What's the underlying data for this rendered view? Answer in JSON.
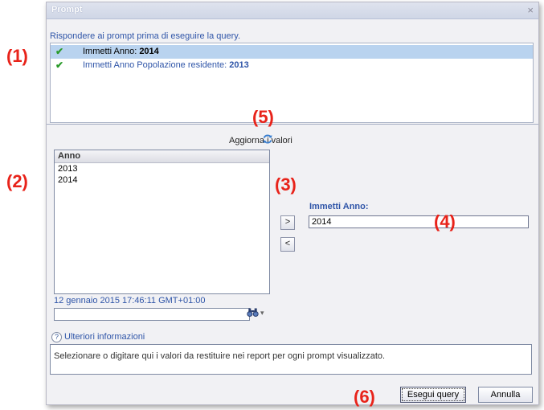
{
  "dialog": {
    "title": "Prompt",
    "close_glyph": "×",
    "instruction": "Rispondere ai prompt prima di eseguire la query."
  },
  "prompts": [
    {
      "label": "Immetti Anno: ",
      "value": "2014",
      "selected": true
    },
    {
      "label": "Immetti Anno Popolazione residente: ",
      "value": "2013",
      "selected": false
    }
  ],
  "values_panel": {
    "refresh_label": "Aggiorna i valori",
    "refresh_icon": "refresh-icon",
    "column_header": "Anno",
    "items": [
      "2013",
      "2014"
    ],
    "timestamp": "12 gennaio 2015 17:46:11 GMT+01:00",
    "search_value": ""
  },
  "arrows": {
    "add": ">",
    "remove": "<"
  },
  "field": {
    "label": "Immetti Anno:",
    "value": "2014"
  },
  "more_info": {
    "label": "Ulteriori informazioni",
    "icon_glyph": "?"
  },
  "description": "Selezionare o digitare qui i valori da restituire nei report per ogni prompt visualizzato.",
  "buttons": {
    "run": "Esegui query",
    "cancel": "Annulla"
  },
  "annotations": [
    "(1)",
    "(2)",
    "(3)",
    "(4)",
    "(5)",
    "(6)"
  ],
  "colors": {
    "accent": "#2f55a8",
    "annotation": "#e8231a",
    "check": "#2a9b2a",
    "selection": "#b9d3ef"
  }
}
